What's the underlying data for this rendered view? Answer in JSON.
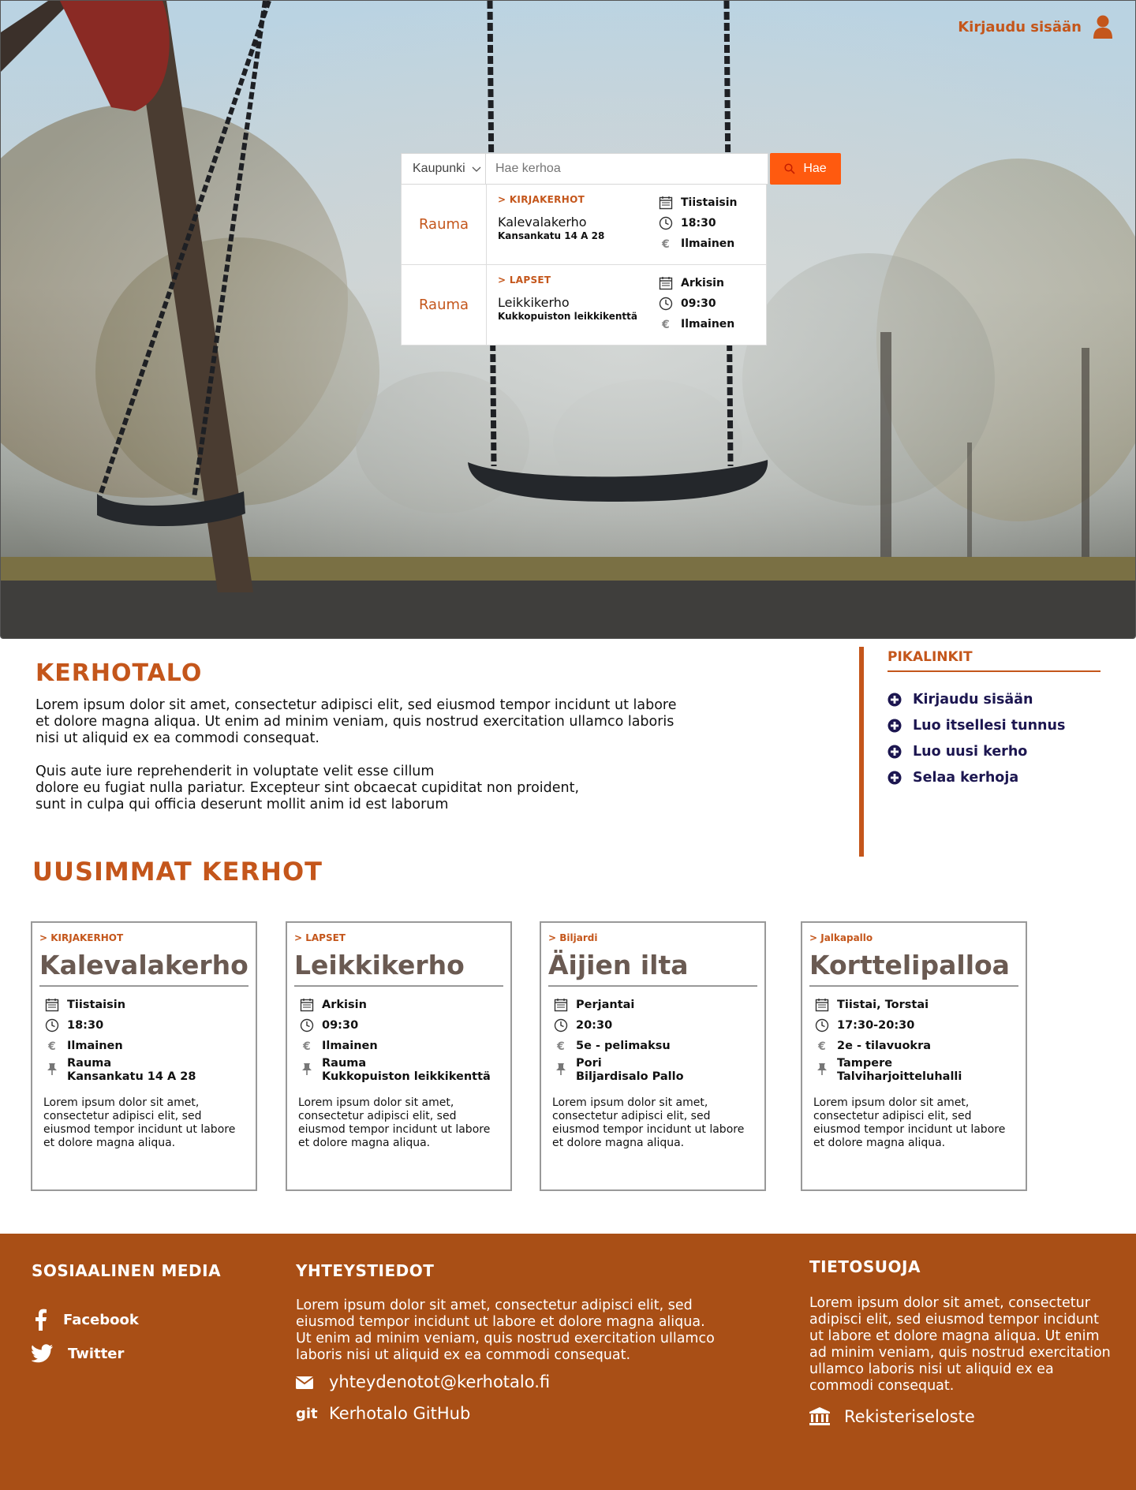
{
  "header": {
    "login_label": "Kirjaudu sisään"
  },
  "search": {
    "city_value": "Kaupunki",
    "placeholder": "Hae kerhoa",
    "button_label": "Hae",
    "results": [
      {
        "city": "Rauma",
        "category": "> KIRJAKERHOT",
        "name": "Kalevalakerho",
        "address": "Kansankatu 14 A 28",
        "day": "Tiistaisin",
        "time": "18:30",
        "price": "Ilmainen"
      },
      {
        "city": "Rauma",
        "category": "> LAPSET",
        "name": "Leikkikerho",
        "address": "Kukkopuiston leikkikenttä",
        "day": "Arkisin",
        "time": "09:30",
        "price": "Ilmainen"
      }
    ]
  },
  "about": {
    "title": "KERHOTALO",
    "paragraph1": "Lorem ipsum dolor sit amet, consectetur adipisci elit, sed eiusmod tempor incidunt ut labore\net dolore magna aliqua. Ut enim ad minim veniam, quis nostrud exercitation ullamco laboris\nnisi ut aliquid ex ea commodi consequat.",
    "paragraph2": "Quis aute iure reprehenderit in voluptate velit esse cillum\ndolore eu fugiat nulla pariatur. Excepteur sint obcaecat cupiditat non proident,\nsunt in culpa qui officia deserunt mollit anim id est laborum"
  },
  "quicklinks": {
    "title": "PIKALINKIT",
    "items": [
      "Kirjaudu sisään",
      "Luo itsellesi tunnus",
      "Luo uusi kerho",
      "Selaa kerhoja"
    ]
  },
  "latest": {
    "title": "UUSIMMAT KERHOT",
    "cards": [
      {
        "category": "> KIRJAKERHOT",
        "title": "Kalevalakerho",
        "day": "Tiistaisin",
        "time": "18:30",
        "price": "Ilmainen",
        "city": "Rauma",
        "place": "Kansankatu 14 A 28",
        "desc": "Lorem ipsum dolor sit amet, consectetur adipisci elit, sed eiusmod tempor incidunt ut labore et dolore magna aliqua."
      },
      {
        "category": "> LAPSET",
        "title": "Leikkikerho",
        "day": "Arkisin",
        "time": "09:30",
        "price": "Ilmainen",
        "city": "Rauma",
        "place": "Kukkopuiston leikkikenttä",
        "desc": "Lorem ipsum dolor sit amet, consectetur adipisci elit, sed eiusmod tempor incidunt ut labore et dolore magna aliqua."
      },
      {
        "category": "> Biljardi",
        "title": "Äijien ilta",
        "day": "Perjantai",
        "time": "20:30",
        "price": "5e - pelimaksu",
        "city": "Pori",
        "place": "Biljardisalo Pallo",
        "desc": "Lorem ipsum dolor sit amet, consectetur adipisci elit, sed eiusmod tempor incidunt ut labore et dolore magna aliqua."
      },
      {
        "category": "> Jalkapallo",
        "title": "Korttelipalloa",
        "day": "Tiistai, Torstai",
        "time": "17:30-20:30",
        "price": "2e - tilavuokra",
        "city": "Tampere",
        "place": "Talviharjoitteluhalli",
        "desc": "Lorem ipsum dolor sit amet, consectetur adipisci elit, sed eiusmod tempor incidunt ut labore et dolore magna aliqua."
      }
    ]
  },
  "footer": {
    "social": {
      "title": "SOSIAALINEN MEDIA",
      "facebook": "Facebook",
      "twitter": "Twitter"
    },
    "contact": {
      "title": "YHTEYSTIEDOT",
      "text": "Lorem ipsum dolor sit amet, consectetur adipisci elit, sed eiusmod tempor incidunt ut labore et dolore magna aliqua. Ut enim ad minim veniam, quis nostrud exercitation ullamco laboris nisi ut aliquid ex ea commodi consequat.",
      "email": "yhteydenotot@kerhotalo.fi",
      "github_icon_label": "git",
      "github": "Kerhotalo GitHub"
    },
    "privacy": {
      "title": "TIETOSUOJA",
      "text": "Lorem ipsum dolor sit amet, consectetur adipisci elit, sed eiusmod tempor incidunt ut labore et dolore magna aliqua. Ut enim ad minim veniam, quis nostrud exercitation ullamco laboris nisi ut aliquid ex ea commodi consequat.",
      "register": "Rekisteriseloste"
    }
  },
  "colors": {
    "accent": "#c4561b",
    "search_button": "#ff5a0f",
    "footer_bg": "#a94f16",
    "quicklink_text": "#1c1650",
    "card_title": "#6a5a52"
  }
}
